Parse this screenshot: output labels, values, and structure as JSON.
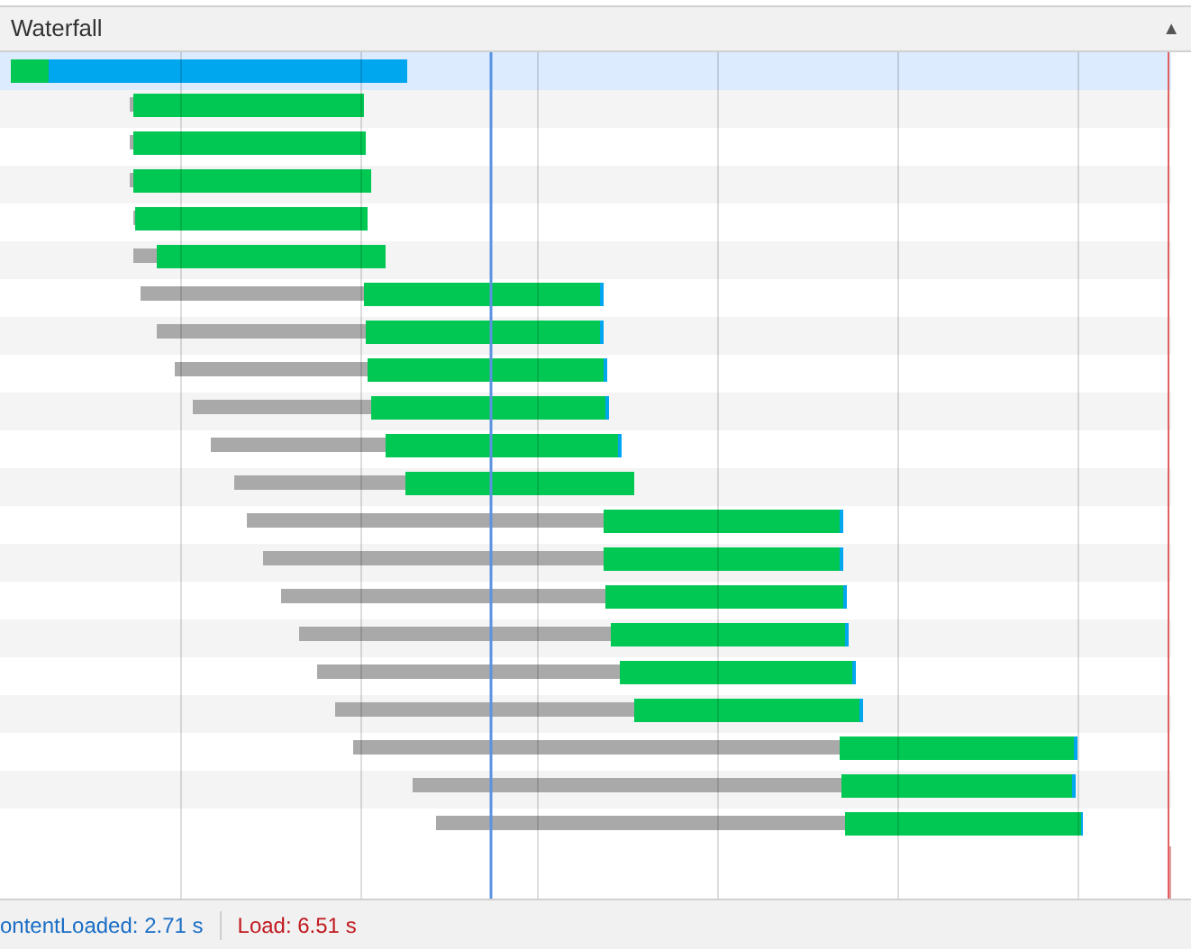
{
  "panel": {
    "title": "Waterfall",
    "toggle": "▲"
  },
  "requests": [
    {
      "selected": true
    },
    {
      "selected": false
    },
    {
      "selected": false
    },
    {
      "selected": false
    },
    {
      "selected": false
    },
    {
      "selected": false
    },
    {
      "selected": false
    },
    {
      "selected": false
    },
    {
      "selected": false
    },
    {
      "selected": false
    },
    {
      "selected": false
    },
    {
      "selected": false
    },
    {
      "selected": false
    },
    {
      "selected": false
    },
    {
      "selected": false
    },
    {
      "selected": false
    },
    {
      "selected": false
    },
    {
      "selected": false
    },
    {
      "selected": false
    },
    {
      "selected": false
    },
    {
      "selected": false
    }
  ],
  "status_bar": {
    "dom_content_loaded": "ontentLoaded: 2.71 s",
    "load": "Load: 6.51 s"
  }
}
